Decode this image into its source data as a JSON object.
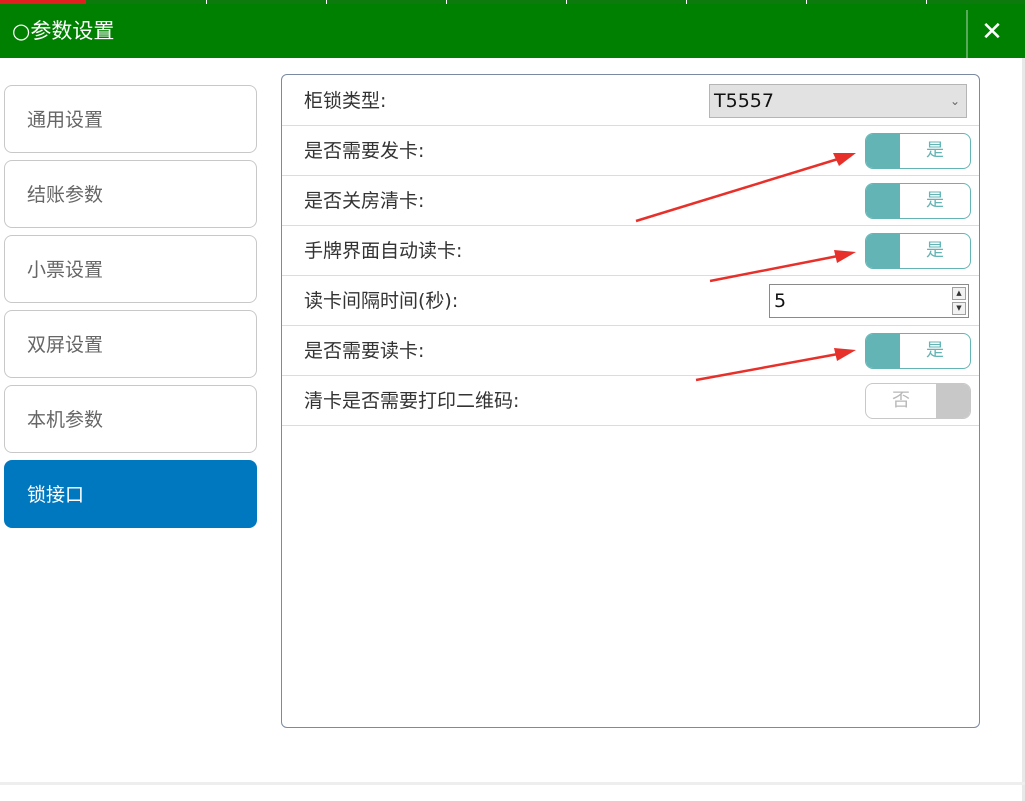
{
  "window": {
    "title": "○参数设置",
    "close_glyph": "✕",
    "titlebar_color": "#008000"
  },
  "sidebar": {
    "active_color": "#0078c0",
    "items": [
      {
        "label": "通用设置",
        "active": false
      },
      {
        "label": "结账参数",
        "active": false
      },
      {
        "label": "小票设置",
        "active": false
      },
      {
        "label": "双屏设置",
        "active": false
      },
      {
        "label": "本机参数",
        "active": false
      },
      {
        "label": "锁接口",
        "active": true
      }
    ]
  },
  "settings": {
    "lock_type": {
      "label": "柜锁类型:",
      "value": "T5557",
      "chevron_icon": "chevron-down-icon"
    },
    "need_issue_card": {
      "label": "是否需要发卡:",
      "toggle_text": "是",
      "on": true
    },
    "clear_card_on_checkout": {
      "label": "是否关房清卡:",
      "toggle_text": "是",
      "on": true
    },
    "tag_screen_auto_read": {
      "label": "手牌界面自动读卡:",
      "toggle_text": "是",
      "on": true
    },
    "read_interval": {
      "label": "读卡间隔时间(秒):",
      "value": "5",
      "up_glyph": "▲",
      "down_glyph": "▼"
    },
    "need_read_card": {
      "label": "是否需要读卡:",
      "toggle_text": "是",
      "on": true
    },
    "print_qr_on_clear": {
      "label": "清卡是否需要打印二维码:",
      "toggle_text": "否",
      "on": false
    }
  },
  "colors": {
    "toggle_on": "#63b5b5",
    "toggle_off": "#c8c8c8",
    "annotation_arrow": "#e8302a"
  }
}
